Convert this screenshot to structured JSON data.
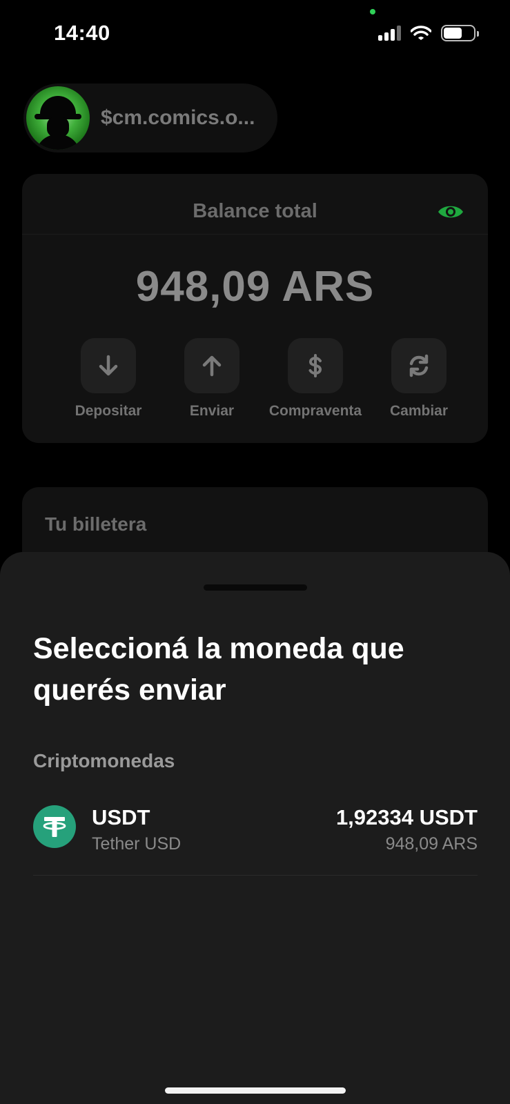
{
  "status_bar": {
    "time": "14:40",
    "icons": [
      "cellular-signal-icon",
      "wifi-icon",
      "battery-icon"
    ],
    "battery_level": 0.62
  },
  "profile": {
    "handle": "$cm.comics.o..."
  },
  "balance": {
    "label": "Balance total",
    "amount": "948,09 ARS",
    "eye_icon_color": "#1fa83f",
    "actions": [
      {
        "label": "Depositar",
        "icon": "arrow-down-icon"
      },
      {
        "label": "Enviar",
        "icon": "arrow-up-icon"
      },
      {
        "label": "Compraventa",
        "icon": "dollar-icon"
      },
      {
        "label": "Cambiar",
        "icon": "refresh-icon"
      }
    ]
  },
  "wallet": {
    "title": "Tu billetera"
  },
  "sheet": {
    "title": "Seleccioná la moneda que querés enviar",
    "section": "Criptomonedas",
    "coins": [
      {
        "symbol": "USDT",
        "name": "Tether USD",
        "amount": "1,92334 USDT",
        "fiat": "948,09 ARS",
        "icon": "tether-icon",
        "icon_color": "#26a17b"
      }
    ]
  }
}
